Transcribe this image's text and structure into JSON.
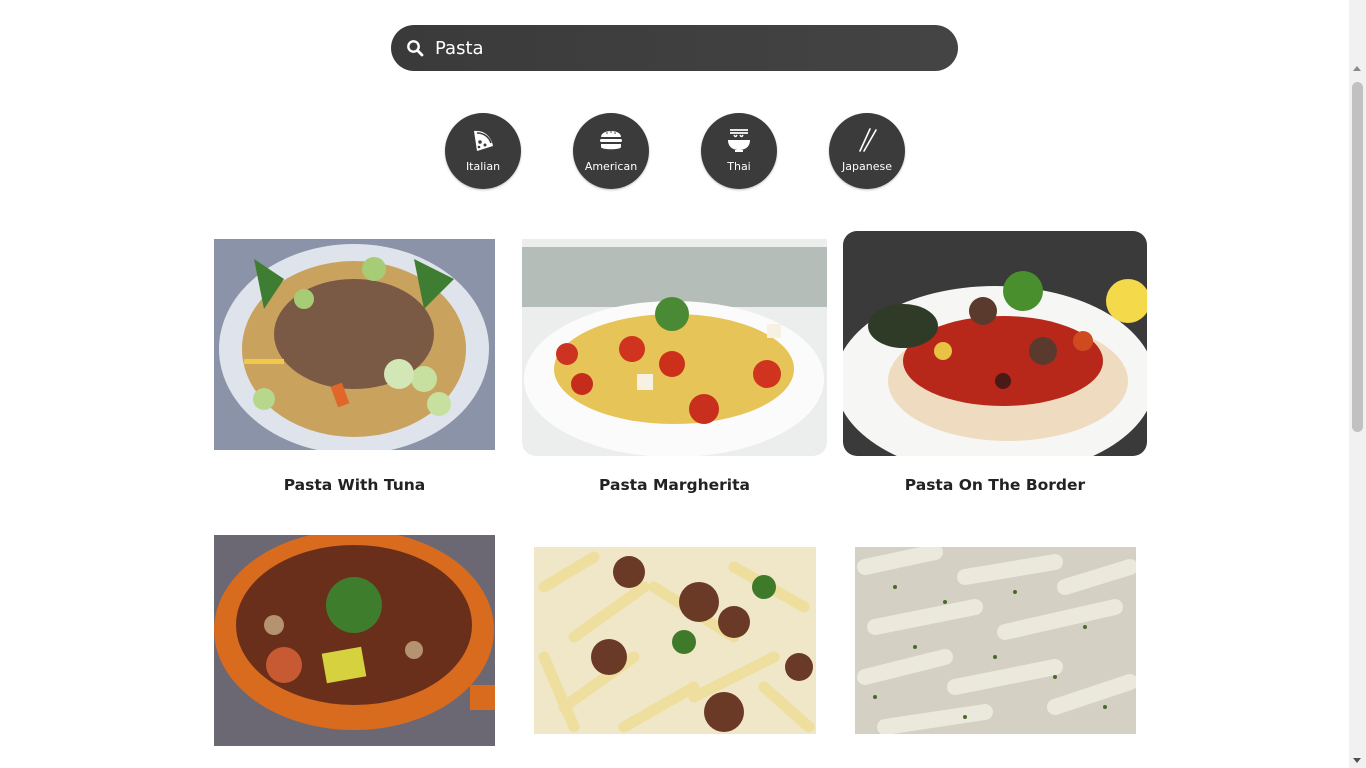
{
  "search": {
    "value": "Pasta",
    "placeholder": ""
  },
  "categories": [
    {
      "label": "Italian",
      "icon": "pizza-icon"
    },
    {
      "label": "American",
      "icon": "burger-icon"
    },
    {
      "label": "Thai",
      "icon": "noodle-bowl-icon"
    },
    {
      "label": "Japanese",
      "icon": "chopsticks-icon"
    }
  ],
  "recipes": [
    {
      "title": "Pasta With Tuna"
    },
    {
      "title": "Pasta Margherita"
    },
    {
      "title": "Pasta On The Border"
    },
    {
      "title": ""
    },
    {
      "title": ""
    },
    {
      "title": ""
    }
  ]
}
